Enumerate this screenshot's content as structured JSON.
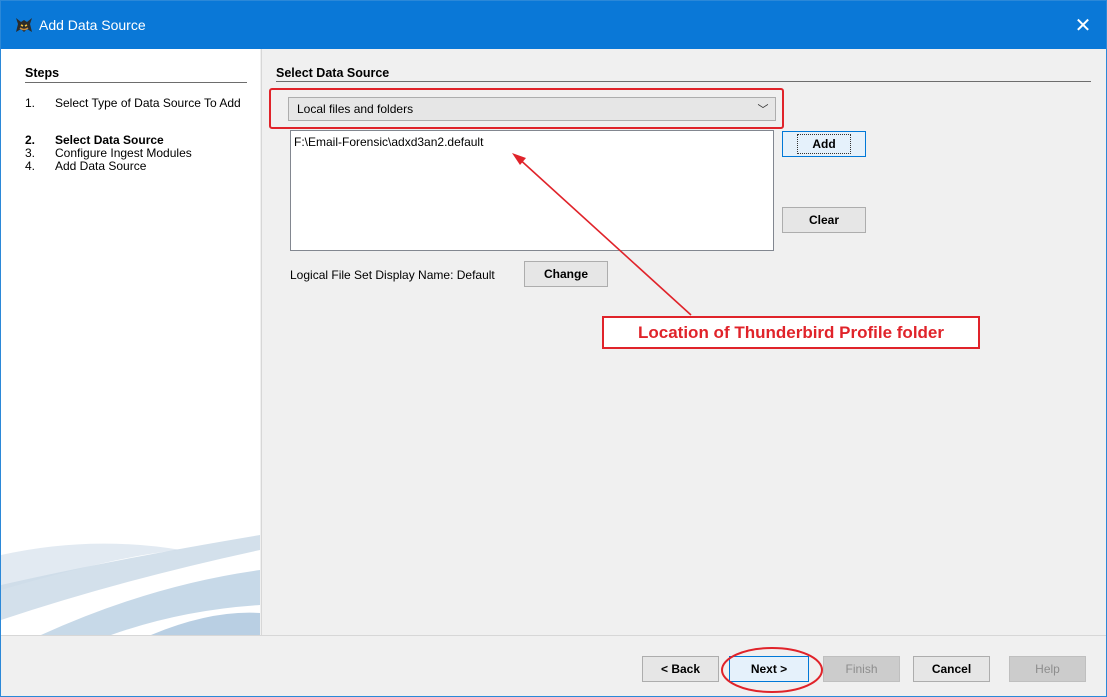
{
  "window": {
    "title": "Add Data Source",
    "close_label": "✕"
  },
  "steps": {
    "header": "Steps",
    "items": [
      {
        "number": "1.",
        "label": "Select Type of Data Source To Add"
      },
      {
        "number": "2.",
        "label": "Select Data Source"
      },
      {
        "number": "3.",
        "label": "Configure Ingest Modules"
      },
      {
        "number": "4.",
        "label": "Add Data Source"
      }
    ],
    "active_index": 1
  },
  "main": {
    "section_title": "Select Data Source",
    "source_type": {
      "selected": "Local files and folders"
    },
    "file_list": [
      "F:\\Email-Forensic\\adxd3an2.default"
    ],
    "add_label": "Add",
    "clear_label": "Clear",
    "logical_file_set_label": "Logical File Set Display Name: Default",
    "change_label": "Change"
  },
  "annotation": {
    "callout": "Location of Thunderbird Profile folder",
    "color": "#e0232a"
  },
  "footer": {
    "back_label": "< Back",
    "next_label": "Next >",
    "finish_label": "Finish",
    "cancel_label": "Cancel",
    "help_label": "Help"
  },
  "colors": {
    "titlebar": "#0a78d7",
    "annotation_red": "#e0232a",
    "focus_blue": "#0078d7"
  }
}
